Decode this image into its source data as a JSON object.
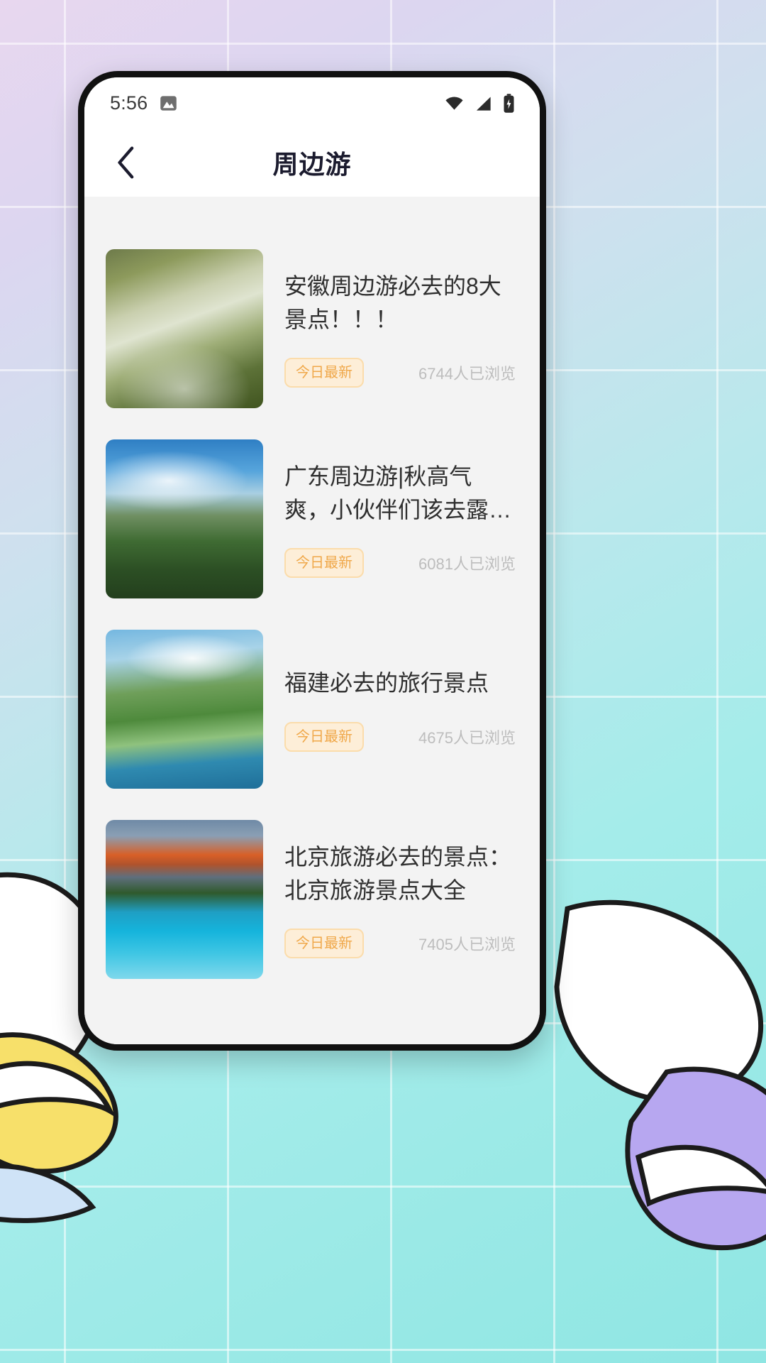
{
  "background": {
    "gradient_from": "#e8d7ef",
    "gradient_to": "#8fe6e3",
    "grid_color": "#ffffff",
    "blob_colors": [
      "#f7e06a",
      "#b7a7f0",
      "#ffffff",
      "#cfe3f7"
    ]
  },
  "statusbar": {
    "time": "5:56",
    "icons": {
      "gallery": "image-icon",
      "wifi": "wifi-icon",
      "signal": "cellular-signal-icon",
      "battery": "battery-icon"
    }
  },
  "navbar": {
    "back": "back-chevron-icon",
    "title": "周边游"
  },
  "list": {
    "items": [
      {
        "title": "安徽周边游必去的8大景点！！！",
        "badge": "今日最新",
        "views": "6744人已浏览",
        "thumb": "lakeside-path-lanterns-photo"
      },
      {
        "title": "广东周边游|秋高气爽，小伙伴们该去露…",
        "badge": "今日最新",
        "views": "6081人已浏览",
        "thumb": "hiker-green-mountain-photo"
      },
      {
        "title": "福建必去的旅行景点",
        "badge": "今日最新",
        "views": "4675人已浏览",
        "thumb": "coastal-green-cliffs-photo"
      },
      {
        "title": "北京旅游必去的景点：北京旅游景点大全",
        "badge": "今日最新",
        "views": "7405人已浏览",
        "thumb": "mountain-lake-reflection-photo"
      }
    ]
  }
}
